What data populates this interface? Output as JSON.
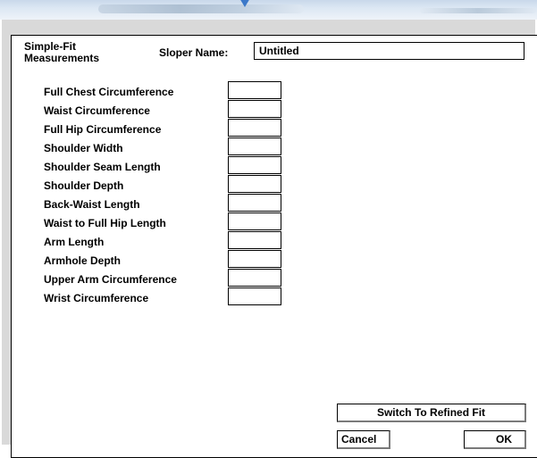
{
  "dialog": {
    "title": "Simple-Fit Measurements",
    "sloper_label": "Sloper Name:",
    "sloper_value": "Untitled"
  },
  "measurements": [
    {
      "label": "Full Chest Circumference",
      "value": ""
    },
    {
      "label": "Waist Circumference",
      "value": ""
    },
    {
      "label": "Full Hip Circumference",
      "value": ""
    },
    {
      "label": "Shoulder Width",
      "value": ""
    },
    {
      "label": "Shoulder Seam Length",
      "value": ""
    },
    {
      "label": "Shoulder Depth",
      "value": ""
    },
    {
      "label": "Back-Waist Length",
      "value": ""
    },
    {
      "label": "Waist to Full Hip Length",
      "value": ""
    },
    {
      "label": "Arm Length",
      "value": ""
    },
    {
      "label": "Armhole Depth",
      "value": ""
    },
    {
      "label": "Upper Arm Circumference",
      "value": ""
    },
    {
      "label": "Wrist Circumference",
      "value": ""
    }
  ],
  "buttons": {
    "switch": "Switch To Refined Fit",
    "cancel": "Cancel",
    "ok": "OK"
  }
}
